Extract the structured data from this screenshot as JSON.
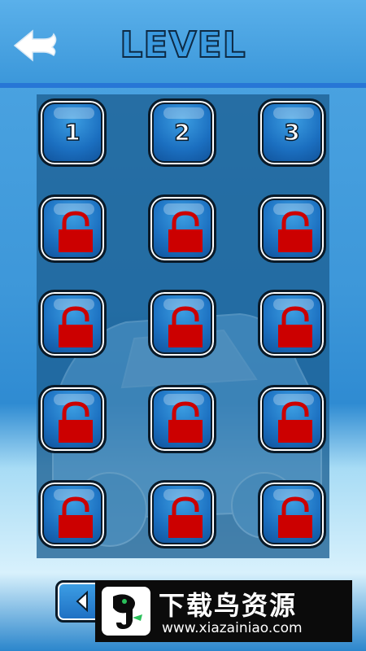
{
  "header": {
    "title": "LEVEL"
  },
  "levels": [
    {
      "label": "1",
      "locked": false
    },
    {
      "label": "2",
      "locked": false
    },
    {
      "label": "3",
      "locked": false
    },
    {
      "label": "",
      "locked": true
    },
    {
      "label": "",
      "locked": true
    },
    {
      "label": "",
      "locked": true
    },
    {
      "label": "",
      "locked": true
    },
    {
      "label": "",
      "locked": true
    },
    {
      "label": "",
      "locked": true
    },
    {
      "label": "",
      "locked": true
    },
    {
      "label": "",
      "locked": true
    },
    {
      "label": "",
      "locked": true
    },
    {
      "label": "",
      "locked": true
    },
    {
      "label": "",
      "locked": true
    },
    {
      "label": "",
      "locked": true
    }
  ],
  "watermark": {
    "name": "下载鸟资源",
    "url": "www.xiazainiao.com"
  },
  "colors": {
    "lock": "#cc0000",
    "button_blue": "#1d6ec2",
    "title_fill": "#3a9ae0"
  },
  "icons": {
    "back": "back-arrow-icon",
    "lock": "padlock-icon",
    "prev": "chevron-left-icon"
  }
}
